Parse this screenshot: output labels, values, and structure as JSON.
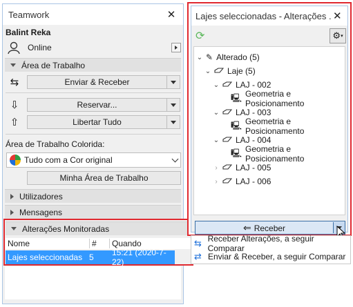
{
  "left_panel": {
    "title": "Teamwork",
    "user_name": "Balint Reka",
    "status": "Online",
    "workspace_section": "Área de Trabalho",
    "send_receive_label": "Enviar & Receber",
    "reserve_label": "Reservar...",
    "release_all_label": "Libertar Tudo",
    "colored_workspace_label": "Área de Trabalho Colorida:",
    "color_option": "Tudo com a Cor original",
    "my_workspace_label": "Minha Área de Trabalho",
    "users_section": "Utilizadores",
    "messages_section": "Mensagens",
    "monitored_section": "Alterações Monitoradas",
    "table": {
      "headers": [
        "Nome",
        "#",
        "Quando"
      ],
      "row": {
        "name": "Lajes seleccionadas",
        "count": "5",
        "when": "15:21 (2020-7-22)"
      }
    }
  },
  "right_panel": {
    "title": "Lajes seleccionadas - Alterações ...",
    "tree": {
      "root": "Alterado (5)",
      "group": "Laje (5)",
      "items": [
        {
          "label": "LAJ - 002",
          "child": "Geometria e Posicionamento",
          "expanded": true
        },
        {
          "label": "LAJ - 003",
          "child": "Geometria e Posicionamento",
          "expanded": true
        },
        {
          "label": "LAJ - 004",
          "child": "Geometria e Posicionamento",
          "expanded": true
        },
        {
          "label": "LAJ - 005",
          "child": "",
          "expanded": false
        },
        {
          "label": "LAJ - 006",
          "child": "",
          "expanded": false
        }
      ]
    },
    "receive_label": "Receber",
    "menu": [
      "Receber Alterações, a seguir Comparar",
      "Enviar & Receber, a seguir Comparar"
    ]
  },
  "colors": {
    "accent_selection": "#3399ff",
    "highlight_red": "#e0282f",
    "window_border": "#a9c4e4"
  }
}
